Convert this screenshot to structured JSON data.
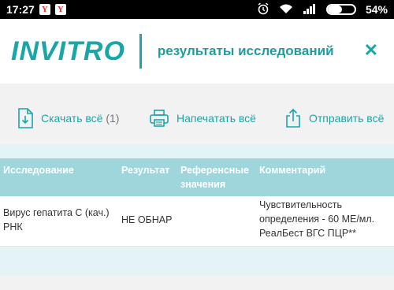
{
  "status_bar": {
    "time": "17:27",
    "battery_percent": "54%",
    "battery_level": 0.54,
    "notification_icons": [
      "yandex-icon",
      "yandex-icon"
    ],
    "system_icons": [
      "alarm-icon",
      "wifi-icon",
      "signal-icon",
      "battery-icon"
    ]
  },
  "header": {
    "logo_text": "INVITRO",
    "title": "результаты исследований",
    "close_icon": "close-icon",
    "accent_color": "#1aa6a7"
  },
  "actions": {
    "download": {
      "label": "Скачать всё",
      "count": "(1)",
      "icon": "download-file-icon"
    },
    "print": {
      "label": "Напечатать всё",
      "icon": "printer-icon"
    },
    "send": {
      "label": "Отправить всё",
      "icon": "share-icon"
    }
  },
  "table": {
    "headers": {
      "study": "Исследование",
      "result": "Результат",
      "reference_line1": "Референсные",
      "reference_line2": "значения",
      "comment": "Комментарий"
    },
    "rows": [
      {
        "study_line1": "Вирус гепатита С (кач.)",
        "study_line2": "РНК",
        "result": "НЕ ОБНАР",
        "reference": "",
        "comment_line1": "Чувствительность",
        "comment_line2": "определения - 60 МЕ/мл.",
        "comment_line3": "РеалБест ВГС ПЦР**"
      }
    ]
  }
}
